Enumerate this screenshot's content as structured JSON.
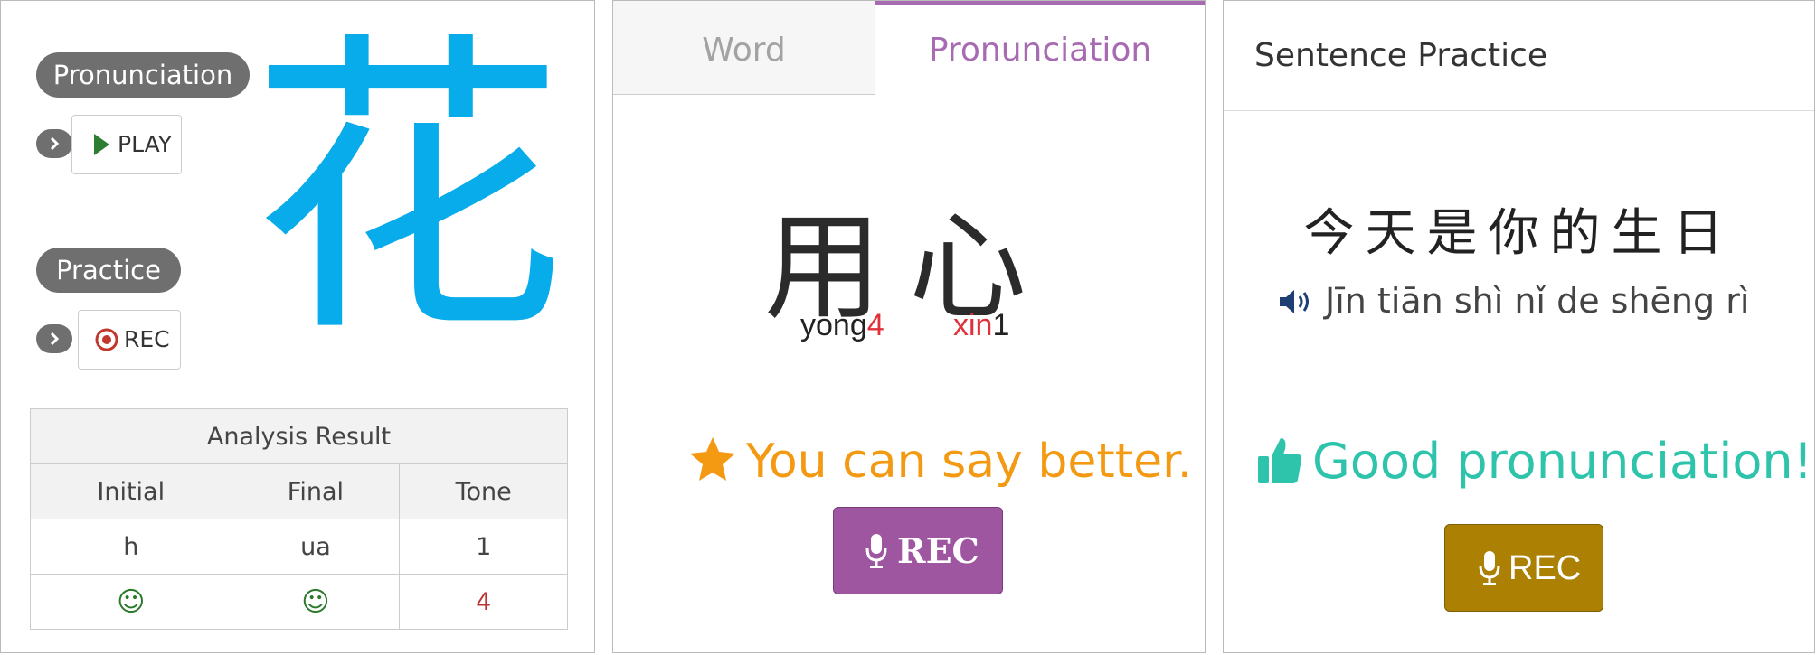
{
  "panel_char": {
    "pronunciation_label": "Pronunciation",
    "play_label": "PLAY",
    "practice_label": "Practice",
    "rec_label": "REC",
    "character": "花",
    "character_color": "#08acea",
    "analysis": {
      "title": "Analysis Result",
      "columns": [
        "Initial",
        "Final",
        "Tone"
      ],
      "values": [
        "h",
        "ua",
        "1"
      ],
      "results": [
        "☺",
        "☺",
        "4"
      ]
    }
  },
  "panel_word": {
    "tabs": [
      "Word",
      "Pronunciation"
    ],
    "active_tab": "Pronunciation",
    "accent_color": "#a76bb2",
    "characters": "用心",
    "syllables": [
      {
        "base": "yong",
        "tone": "4",
        "base_color": "#222222",
        "tone_color": "#e0303a"
      },
      {
        "base": "xin",
        "tone": "1",
        "base_color": "#e0303a",
        "tone_color": "#222222"
      }
    ],
    "feedback": "You can say better.",
    "feedback_icon": "star-icon",
    "feedback_color": "#f39a12",
    "rec_label": "REC",
    "rec_color": "#9e56a0"
  },
  "panel_sentence": {
    "title": "Sentence Practice",
    "hanzi": "今天是你的生日",
    "pinyin": "Jīn tiān shì nǐ de shēng rì",
    "speaker_icon": "speaker-icon",
    "feedback": "Good pronunciation!",
    "feedback_icon": "thumbs-up-icon",
    "feedback_color": "#2ec3ab",
    "rec_label": "REC",
    "rec_color": "#ac8103"
  }
}
